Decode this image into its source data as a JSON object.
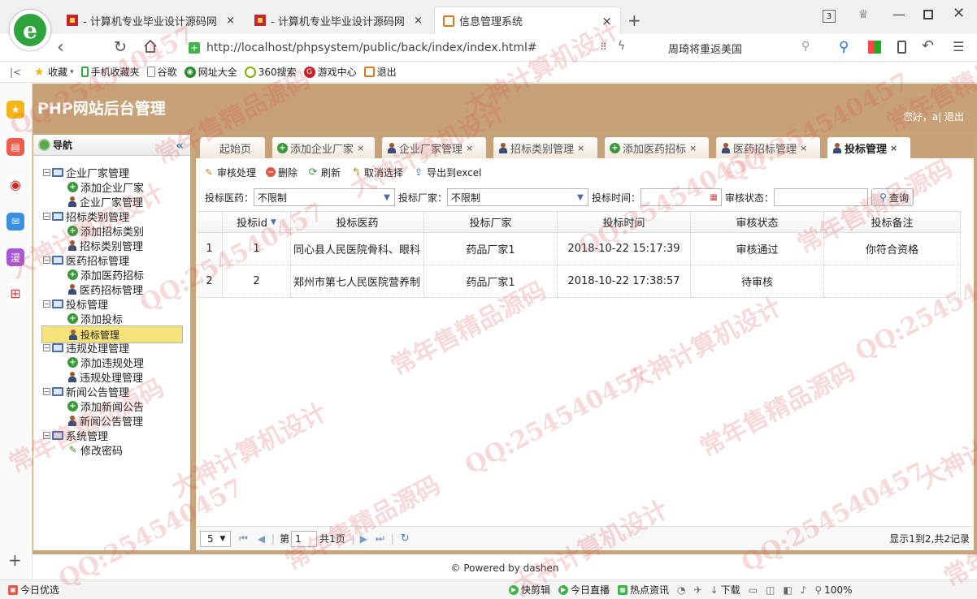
{
  "browser": {
    "tabs": [
      {
        "label": "- 计算机专业毕业设计源码网",
        "close": "×"
      },
      {
        "label": "- 计算机专业毕业设计源码网",
        "close": "×"
      },
      {
        "label": "信息管理系统",
        "close": "×"
      }
    ],
    "new_tab": "+",
    "tab_count": "3",
    "url": "http://localhost/phpsystem/public/back/index/index.html#",
    "search_text": "周琦将重返美国",
    "bookmarks": [
      "收藏",
      "手机收藏夹",
      "谷歌",
      "网址大全",
      "360搜索",
      "游戏中心",
      "退出"
    ],
    "zoom": "100%"
  },
  "app": {
    "title": "PHP网站后台管理",
    "greeting": "您好，a| 退出",
    "footer": "© Powered by dashen"
  },
  "nav": {
    "header": "导航",
    "collapse": "«",
    "groups": [
      {
        "label": "企业厂家管理",
        "items": [
          {
            "label": "添加企业厂家",
            "icon": "plus"
          },
          {
            "label": "企业厂家管理",
            "icon": "person"
          }
        ]
      },
      {
        "label": "招标类别管理",
        "items": [
          {
            "label": "添加招标类别",
            "icon": "plus"
          },
          {
            "label": "招标类别管理",
            "icon": "person"
          }
        ]
      },
      {
        "label": "医药招标管理",
        "items": [
          {
            "label": "添加医药招标",
            "icon": "plus"
          },
          {
            "label": "医药招标管理",
            "icon": "person"
          }
        ]
      },
      {
        "label": "投标管理",
        "items": [
          {
            "label": "添加投标",
            "icon": "plus"
          },
          {
            "label": "投标管理",
            "icon": "person"
          }
        ]
      },
      {
        "label": "违规处理管理",
        "items": [
          {
            "label": "添加违规处理",
            "icon": "plus"
          },
          {
            "label": "违规处理管理",
            "icon": "person"
          }
        ]
      },
      {
        "label": "新闻公告管理",
        "items": [
          {
            "label": "添加新闻公告",
            "icon": "plus"
          },
          {
            "label": "新闻公告管理",
            "icon": "person"
          }
        ]
      },
      {
        "label": "系统管理",
        "items": [
          {
            "label": "修改密码",
            "icon": "pen"
          }
        ]
      }
    ]
  },
  "page_tabs": [
    {
      "label": "起始页",
      "icon": "none",
      "close": ""
    },
    {
      "label": "添加企业厂家",
      "icon": "plus",
      "close": "×"
    },
    {
      "label": "企业厂家管理",
      "icon": "person",
      "close": "×"
    },
    {
      "label": "招标类别管理",
      "icon": "person",
      "close": "×"
    },
    {
      "label": "添加医药招标",
      "icon": "plus",
      "close": "×"
    },
    {
      "label": "医药招标管理",
      "icon": "person",
      "close": "×"
    },
    {
      "label": "投标管理",
      "icon": "person",
      "close": "×"
    }
  ],
  "toolbar": {
    "review": "审核处理",
    "delete": "删除",
    "refresh": "刷新",
    "cancel_select": "取消选择",
    "export": "导出到excel"
  },
  "search": {
    "drug_label": "投标医药：",
    "drug_value": "不限制",
    "maker_label": "投标厂家：",
    "maker_value": "不限制",
    "time_label": "投标时间：",
    "time_value": "",
    "status_label": "审核状态：",
    "status_value": "",
    "query_button": "查询"
  },
  "table": {
    "columns": [
      "投标id",
      "投标医药",
      "投标厂家",
      "投标时间",
      "审核状态",
      "投标备注"
    ],
    "rows": [
      {
        "n": "1",
        "id": "1",
        "drug": "同心县人民医院骨科、眼科",
        "maker": "药品厂家1",
        "time": "2018-10-22 15:17:39",
        "status": "审核通过",
        "note": "你符合资格"
      },
      {
        "n": "2",
        "id": "2",
        "drug": "郑州市第七人民医院营养制",
        "maker": "药品厂家1",
        "time": "2018-10-22 17:38:57",
        "status": "待审核",
        "note": ""
      }
    ]
  },
  "pager": {
    "page_size": "5",
    "page_prefix": "第",
    "page": "1",
    "page_suffix": "共1页",
    "summary": "显示1到2,共2记录"
  },
  "statusbar": {
    "left": "今日优选",
    "items": [
      "快剪辑",
      "今日直播",
      "热点资讯",
      "下载"
    ]
  },
  "watermark": [
    "QQ:254540457",
    "常年售精品源码",
    "大神计算机设计"
  ]
}
